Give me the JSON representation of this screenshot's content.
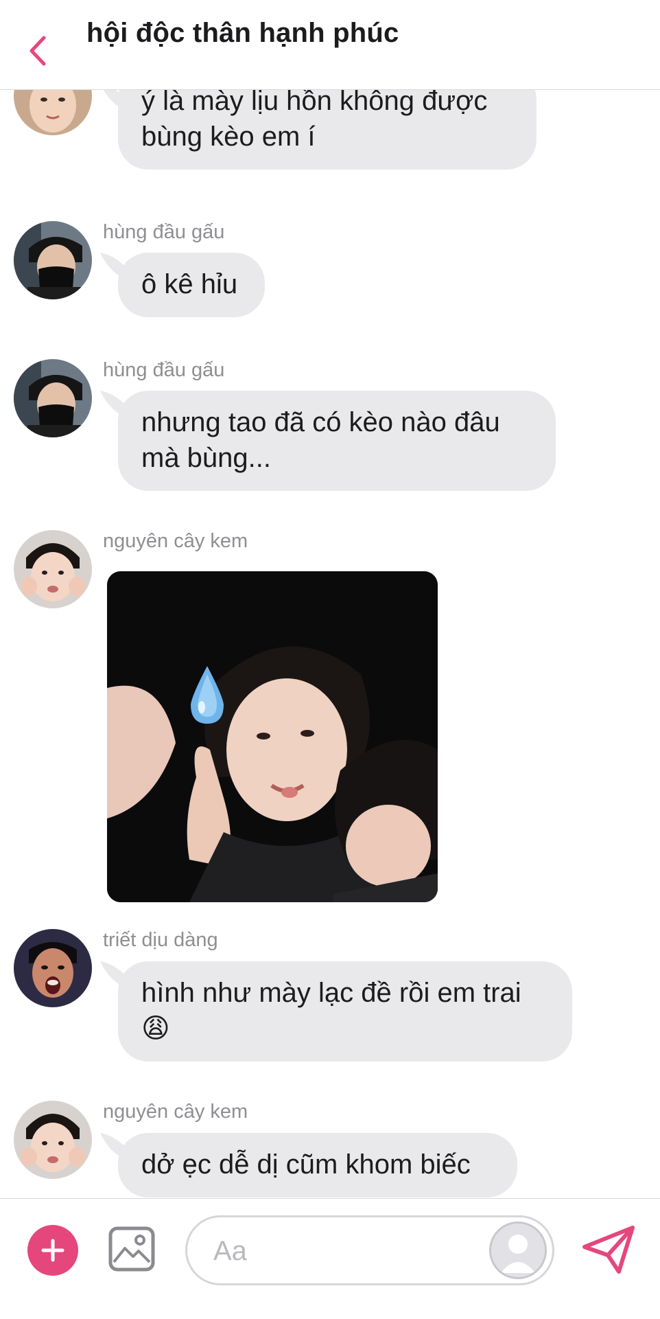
{
  "header": {
    "title": "hội độc thân hạnh phúc",
    "accent_color": "#e5477d"
  },
  "messages": [
    {
      "sender": "",
      "type": "text",
      "lines": [
        "ý là mày lịu hồn không được",
        "bùng kèo em í"
      ]
    },
    {
      "sender": "hùng đầu gấu",
      "type": "text",
      "lines": [
        "ô kê hỉu"
      ]
    },
    {
      "sender": "hùng đầu gấu",
      "type": "text",
      "lines": [
        "nhưng tao đã có kèo nào đâu",
        "mà bùng..."
      ]
    },
    {
      "sender": "nguyên cây kem",
      "type": "image",
      "image_icon": "water-drop-icon"
    },
    {
      "sender": "triết dịu dàng",
      "type": "text",
      "lines": [
        "hình như mày lạc đề rồi em trai",
        "😩"
      ]
    },
    {
      "sender": "nguyên cây kem",
      "type": "text",
      "lines": [
        "dở ẹc dễ dị cũm khom biếc"
      ]
    }
  ],
  "composer": {
    "placeholder": "Aa",
    "value": "",
    "icons": [
      "plus-icon",
      "image-icon",
      "sticker-avatar-icon",
      "send-icon"
    ]
  }
}
